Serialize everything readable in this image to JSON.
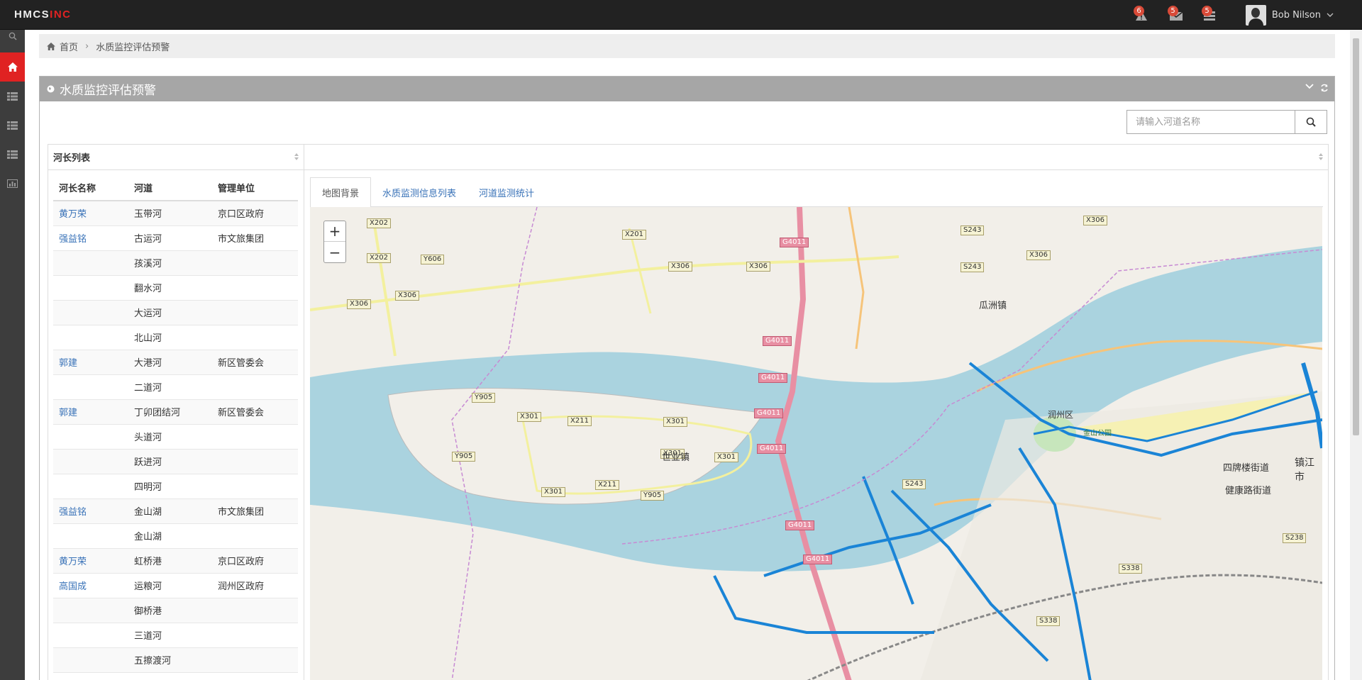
{
  "topbar": {
    "brand_main": "HMCS",
    "brand_accent": "INC",
    "notifications": [
      {
        "icon": "warning-icon",
        "count": "6"
      },
      {
        "icon": "inbox-icon",
        "count": "5"
      },
      {
        "icon": "tasks-icon",
        "count": "5"
      }
    ],
    "user_name": "Bob Nilson"
  },
  "breadcrumb": {
    "home": "首页",
    "current": "水质监控评估预警"
  },
  "portlet": {
    "title": "水质监控评估预警",
    "search_placeholder": "请输入河道名称"
  },
  "river_list": {
    "title": "河长列表",
    "columns": [
      "河长名称",
      "河道",
      "管理单位"
    ],
    "rows": [
      [
        "黄万荣",
        "玉带河",
        "京口区政府"
      ],
      [
        "强益铭",
        "古运河",
        "市文旅集团"
      ],
      [
        "",
        "孩溪河",
        ""
      ],
      [
        "",
        "翻水河",
        ""
      ],
      [
        "",
        "大运河",
        ""
      ],
      [
        "",
        "北山河",
        ""
      ],
      [
        "郭建",
        "大港河",
        "新区管委会"
      ],
      [
        "",
        "二道河",
        ""
      ],
      [
        "郭建",
        "丁卯团结河",
        "新区管委会"
      ],
      [
        "",
        "头道河",
        ""
      ],
      [
        "",
        "跃进河",
        ""
      ],
      [
        "",
        "四明河",
        ""
      ],
      [
        "强益铭",
        "金山湖",
        "市文旅集团"
      ],
      [
        "",
        "金山湖",
        ""
      ],
      [
        "黄万荣",
        "虹桥港",
        "京口区政府"
      ],
      [
        "高国成",
        "运粮河",
        "润州区政府"
      ],
      [
        "",
        "御桥港",
        ""
      ],
      [
        "",
        "三道河",
        ""
      ],
      [
        "",
        "五擦渡河",
        ""
      ]
    ]
  },
  "map_panel": {
    "tabs": [
      "地图背景",
      "水质监测信息列表",
      "河道监测统计"
    ],
    "active_tab": "地图背景",
    "zoom_in": "+",
    "zoom_out": "−",
    "road_labels": [
      "X202",
      "X202",
      "Y606",
      "X306",
      "X306",
      "X201",
      "X306",
      "X306",
      "S243",
      "S243",
      "X306",
      "X306",
      "G4011",
      "G4011",
      "G4011",
      "G4011",
      "G4011",
      "G4011",
      "G4011",
      "Y905",
      "X301",
      "X211",
      "X301",
      "X301",
      "X301",
      "X211",
      "Y905",
      "X301",
      "Y905",
      "S243",
      "S338",
      "S338",
      "S238"
    ],
    "towns": [
      "瓜洲镇",
      "世业镇",
      "润州区",
      "金山公园",
      "四牌楼街道",
      "镇江市",
      "健康路街道"
    ]
  },
  "colors": {
    "topbar": "#222222",
    "accent": "#e02222",
    "sidebar": "#3d3d3d",
    "portlet_title": "#a6a6a6",
    "link": "#3a73b8",
    "river": "#aad3df",
    "land": "#f2efe9",
    "highlight_river": "#1a84d6"
  }
}
